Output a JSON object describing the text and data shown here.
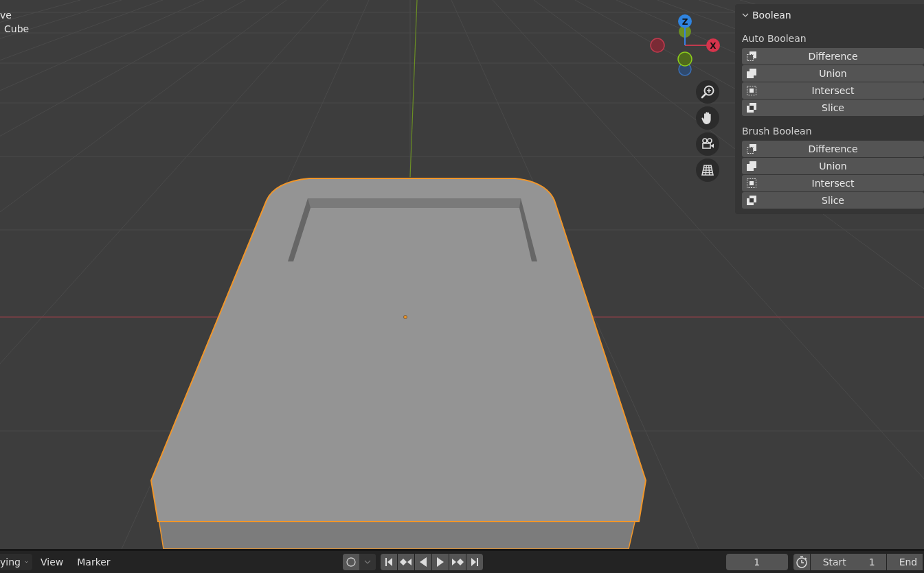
{
  "viewport": {
    "overlay_texts": [
      "ve",
      "Cube"
    ],
    "gizmo_axes": [
      "Z",
      "X"
    ]
  },
  "sidebar_panel": {
    "title": "Boolean",
    "expanded": true,
    "sections": [
      {
        "heading": "Auto Boolean",
        "buttons": [
          {
            "label": "Difference",
            "kind": "difference"
          },
          {
            "label": "Union",
            "kind": "union"
          },
          {
            "label": "Intersect",
            "kind": "intersect"
          },
          {
            "label": "Slice",
            "kind": "slice"
          }
        ]
      },
      {
        "heading": "Brush Boolean",
        "buttons": [
          {
            "label": "Difference",
            "kind": "difference"
          },
          {
            "label": "Union",
            "kind": "union"
          },
          {
            "label": "Intersect",
            "kind": "intersect"
          },
          {
            "label": "Slice",
            "kind": "slice"
          }
        ]
      }
    ]
  },
  "timeline": {
    "mode_dropdown": "ying",
    "menus": [
      "View",
      "Marker"
    ],
    "current_frame": "1",
    "start_label": "Start",
    "start_value": "1",
    "end_label": "End"
  }
}
